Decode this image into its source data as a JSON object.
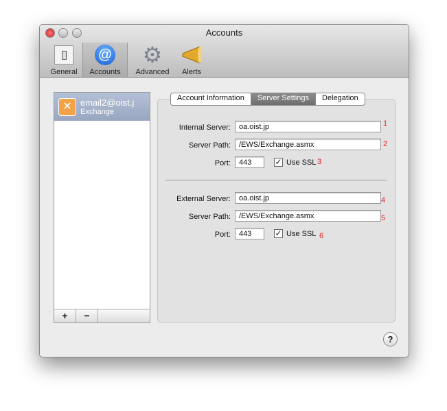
{
  "window": {
    "title": "Accounts"
  },
  "toolbar": {
    "items": [
      {
        "label": "General",
        "icon": "switch-icon"
      },
      {
        "label": "Accounts",
        "icon": "at-icon"
      },
      {
        "label": "Advanced",
        "icon": "gear-icon"
      },
      {
        "label": "Alerts",
        "icon": "megaphone-icon"
      }
    ],
    "selected": "Accounts"
  },
  "accounts": [
    {
      "email": "email2@oist.j",
      "type": "Exchange"
    }
  ],
  "list_buttons": {
    "add": "+",
    "remove": "−"
  },
  "tabs": [
    {
      "label": "Account Information"
    },
    {
      "label": "Server Settings",
      "selected": true
    },
    {
      "label": "Delegation"
    }
  ],
  "internal": {
    "server_label": "Internal Server:",
    "server": "oa.oist.jp",
    "path_label": "Server Path:",
    "path": "/EWS/Exchange.asmx",
    "port_label": "Port:",
    "port": "443",
    "ssl_label": "Use SSL",
    "ssl": true
  },
  "external": {
    "server_label": "External Server:",
    "server": "oa.oist.jp",
    "path_label": "Server Path:",
    "path": "/EWS/Exchange.asmx",
    "port_label": "Port:",
    "port": "443",
    "ssl_label": "Use SSL",
    "ssl": true
  },
  "annotations": [
    "1",
    "2",
    "3",
    "4",
    "5",
    "6"
  ],
  "help": "?",
  "colors": {
    "annotation": "#dd2222",
    "selection": "#9ca9c3"
  }
}
